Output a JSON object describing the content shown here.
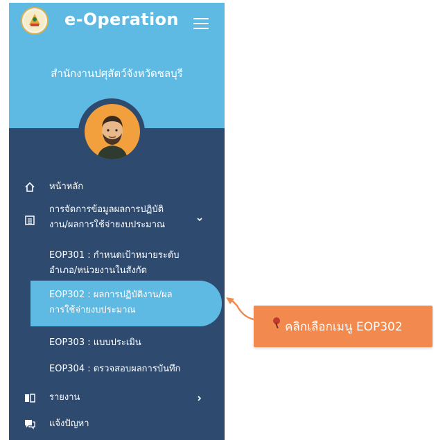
{
  "app": {
    "title": "e-Operation",
    "org_name": "สำนักงานปศุสัตว์จังหวัดชลบุรี"
  },
  "sidebar": {
    "items": [
      {
        "label": "หน้าหลัก",
        "icon": "home-icon"
      },
      {
        "label_line1": "การจัดการข้อมูลผลการปฏิบัติ",
        "label_line2": "งาน/ผลการใช้จ่ายงบประมาณ",
        "icon": "document-list-icon",
        "expanded": true
      },
      {
        "label": "รายงาน",
        "icon": "book-icon"
      },
      {
        "label": "แจ้งปัญหา",
        "icon": "chat-icon"
      }
    ],
    "subitems": [
      {
        "line1": "EOP301 : กำหนดเป้าหมายระดับ",
        "line2": "อำเภอ/หน่วยงานในสังกัด"
      },
      {
        "line1": "EOP302 : ผลการปฏิบัติงาน/ผล",
        "line2": "การใช้จ่ายงบประมาณ",
        "active": true
      },
      {
        "line1": "EOP303 : แบบประเมิน"
      },
      {
        "line1": "EOP304 : ตรวจสอบผลการบันทึก"
      }
    ]
  },
  "callout": {
    "text": "คลิกเลือกเมนู EOP302"
  },
  "colors": {
    "sidebar_bg": "#2e4a6e",
    "header_bg": "#5eb9e3",
    "active_bg": "#5eb9e3",
    "callout_bg": "#f28a4f",
    "avatar_bg": "#f2a03d"
  }
}
